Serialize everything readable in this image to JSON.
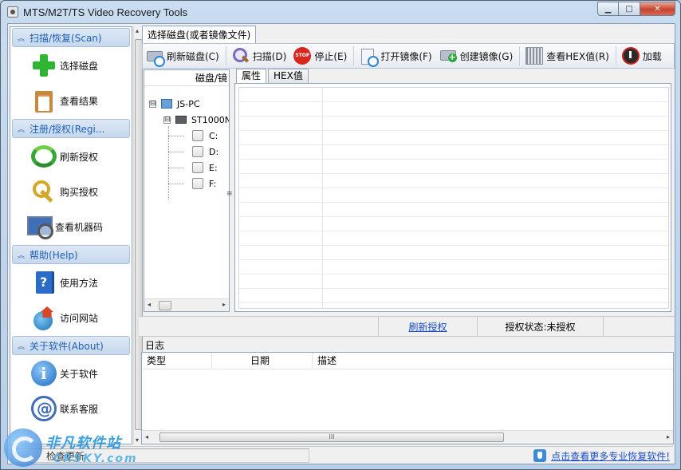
{
  "window": {
    "title": "MTS/M2T/TS Video Recovery Tools",
    "controls": {
      "minimize": "▁",
      "maximize": "□",
      "close": "✕"
    }
  },
  "sidebar": {
    "sections": [
      {
        "title": "扫描/恢复(Scan)",
        "items": [
          {
            "label": "选择磁盘",
            "icon": "add-icon"
          },
          {
            "label": "查看结果",
            "icon": "clipboard-icon"
          }
        ]
      },
      {
        "title": "注册/授权(Regi...",
        "items": [
          {
            "label": "刷新授权",
            "icon": "refresh-icon"
          },
          {
            "label": "购买授权",
            "icon": "key-icon"
          },
          {
            "label": "查看机器码",
            "icon": "monitor-search-icon"
          }
        ]
      },
      {
        "title": "帮助(Help)",
        "items": [
          {
            "label": "使用方法",
            "icon": "help-book-icon"
          },
          {
            "label": "访问网站",
            "icon": "globe-home-icon"
          }
        ]
      },
      {
        "title": "关于软件(About)",
        "items": [
          {
            "label": "关于软件",
            "icon": "info-icon"
          },
          {
            "label": "联系客服",
            "icon": "email-icon"
          }
        ]
      }
    ]
  },
  "main": {
    "tab": "选择磁盘(或者镜像文件)",
    "toolbar": {
      "refresh_disk": "刷新磁盘(C)",
      "scan": "扫描(D)",
      "stop": "停止(E)",
      "open_image": "打开镜像(F)",
      "create_image": "创建镜像(G)",
      "view_hex": "查看HEX值(R)",
      "load": "加载"
    },
    "tree": {
      "header": "磁盘/镜",
      "toggle_collapsed": "⊟",
      "root": "JS-PC",
      "disk": "ST1000N",
      "drives": [
        "C:",
        "D:",
        "E:",
        "F:"
      ]
    },
    "prop_tabs": [
      "属性",
      "HEX值"
    ],
    "status": {
      "refresh_license": "刷新授权",
      "license_state": "授权状态:未授权"
    },
    "log": {
      "label": "日志",
      "columns": [
        "类型",
        "日期",
        "描述"
      ]
    }
  },
  "footer": {
    "left_text": "检查更新",
    "right_link": "点击查看更多专业恢复软件!"
  },
  "watermark": {
    "cn": "非凡软件站",
    "en": "CRSKY.com"
  },
  "scroll": {
    "left": "◂",
    "right": "▸",
    "up": "▴",
    "down": "▾",
    "grip": "≡",
    "thumb_grip": "III"
  }
}
